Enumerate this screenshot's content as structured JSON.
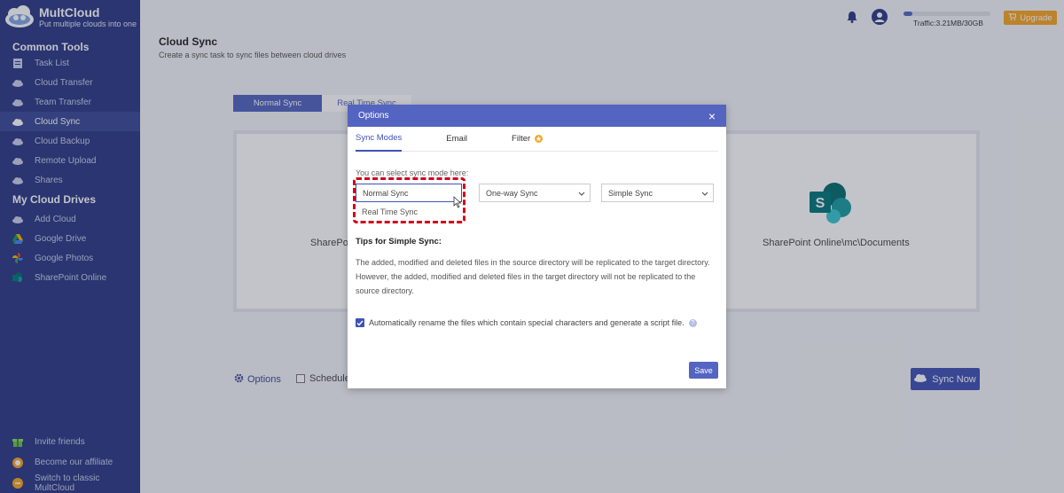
{
  "app": {
    "name": "MultCloud",
    "tagline": "Put multiple clouds into one"
  },
  "sidebar": {
    "common_tools_title": "Common Tools",
    "common_tools": [
      {
        "label": "Task List",
        "icon": "list-icon"
      },
      {
        "label": "Cloud Transfer",
        "icon": "cloud-transfer-icon"
      },
      {
        "label": "Team Transfer",
        "icon": "team-transfer-icon"
      },
      {
        "label": "Cloud Sync",
        "icon": "cloud-sync-icon",
        "active": true
      },
      {
        "label": "Cloud Backup",
        "icon": "cloud-backup-icon"
      },
      {
        "label": "Remote Upload",
        "icon": "remote-upload-icon"
      },
      {
        "label": "Shares",
        "icon": "shares-icon"
      }
    ],
    "my_drives_title": "My Cloud Drives",
    "drives": [
      {
        "label": "Add Cloud",
        "icon": "add-cloud-icon"
      },
      {
        "label": "Google Drive",
        "icon": "google-drive-icon"
      },
      {
        "label": "Google Photos",
        "icon": "google-photos-icon"
      },
      {
        "label": "SharePoint Online",
        "icon": "sharepoint-icon"
      }
    ],
    "bottom": [
      {
        "label": "Invite friends",
        "icon": "gift-icon"
      },
      {
        "label": "Become our affiliate",
        "icon": "affiliate-icon"
      },
      {
        "label": "Switch to classic MultCloud",
        "icon": "switch-icon"
      }
    ]
  },
  "topbar": {
    "traffic": "Traffic:3.21MB/30GB",
    "traffic_used_fraction": 0.1,
    "upgrade": "Upgrade"
  },
  "main": {
    "title": "Cloud Sync",
    "subtitle": "Create a sync task to sync files between cloud drives",
    "tab_normal": "Normal Sync",
    "tab_real": "Real Time Sync",
    "source_label": "SharePo",
    "target_label": "SharePoint Online\\mc\\Documents",
    "options_label": "Options",
    "schedule_label": "Schedule",
    "sync_now": "Sync Now"
  },
  "modal": {
    "title": "Options",
    "close": "×",
    "tabs": [
      "Sync Modes",
      "Email",
      "Filter"
    ],
    "select_hint": "You can select sync mode here:",
    "sync_type_value": "Normal Sync",
    "sync_type_option_2": "Real Time Sync",
    "direction_value": "One-way Sync",
    "method_value": "Simple Sync",
    "tips_title": "Tips for Simple Sync:",
    "tips_body": "The added, modified and deleted files in the source directory will be replicated to the target directory. However, the added, modified and deleted files in the target directory will not be replicated to the source directory.",
    "auto_rename_label": "Automatically rename the files which contain special characters and generate a script file.",
    "save": "Save"
  },
  "colors": {
    "sidebar_bg": "#2b3a86",
    "accent": "#3f51b5",
    "upgrade": "#f5a623",
    "highlight": "#d0021b"
  }
}
